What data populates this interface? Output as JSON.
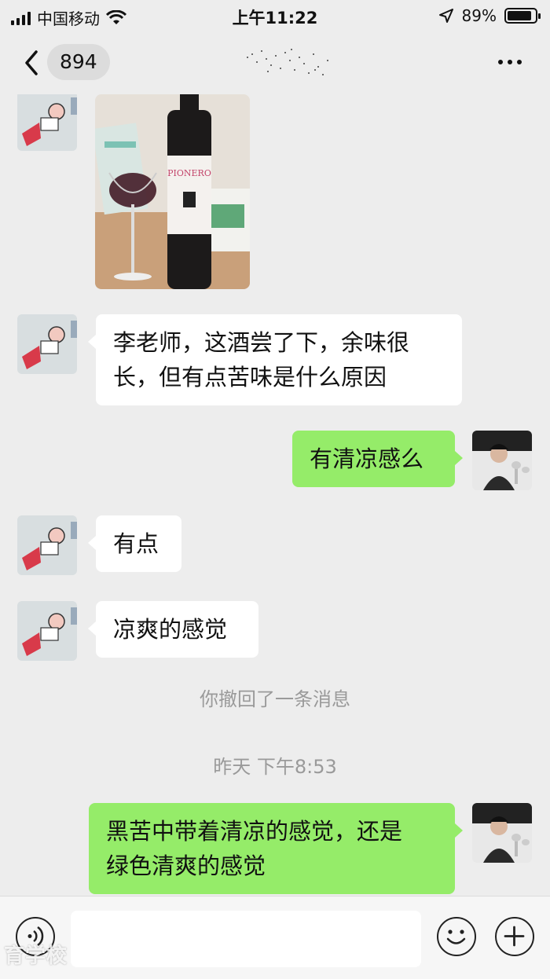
{
  "status_bar": {
    "carrier": "中国移动",
    "time": "上午11:22",
    "battery": "89%",
    "battery_level": 0.89,
    "icons": [
      "signal-icon",
      "wifi-icon",
      "location-arrow-icon",
      "battery-icon"
    ]
  },
  "nav": {
    "back_icon": "chevron-left-icon",
    "unread_count": "894",
    "more_icon": "more-dots-icon"
  },
  "messages": [
    {
      "sender": "other",
      "type": "image",
      "content": "wine-bottle-photo"
    },
    {
      "sender": "other",
      "type": "text",
      "lines": [
        "李老师，这酒尝了下，余味很",
        "长，但有点苦味是什么原因"
      ]
    },
    {
      "sender": "self",
      "type": "text",
      "lines": [
        "有清凉感么"
      ]
    },
    {
      "sender": "other",
      "type": "text",
      "lines": [
        "有点"
      ]
    },
    {
      "sender": "other",
      "type": "text",
      "lines": [
        "凉爽的感觉"
      ]
    },
    {
      "type": "system",
      "text": "你撤回了一条消息"
    },
    {
      "type": "timestamp",
      "text": "昨天 下午8:53"
    },
    {
      "sender": "self",
      "type": "text",
      "lines": [
        "黑苦中带着清凉的感觉，还是",
        "绿色清爽的感觉"
      ]
    }
  ],
  "photo": {
    "bottle_label": "PIONERO"
  },
  "input_bar": {
    "voice_icon": "voice-icon",
    "input_value": "",
    "emoji_icon": "smiley-icon",
    "plus_icon": "plus-icon"
  },
  "watermark": "育学校",
  "colors": {
    "background": "#ededed",
    "incoming_bubble": "#ffffff",
    "outgoing_bubble": "#95ec69"
  }
}
